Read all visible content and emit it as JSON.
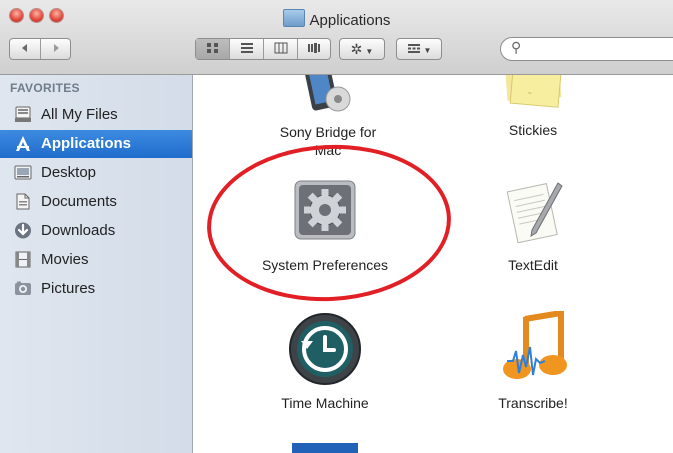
{
  "window": {
    "title": "Applications"
  },
  "toolbar": {
    "back_icon": "back-arrow-icon",
    "forward_icon": "forward-arrow-icon",
    "view_icons": [
      "icon-view-icon",
      "list-view-icon",
      "column-view-icon",
      "coverflow-view-icon"
    ],
    "action_icon": "gear-icon",
    "arrange_icon": "arrange-icon",
    "search_placeholder": ""
  },
  "sidebar": {
    "section": "FAVORITES",
    "items": [
      {
        "label": "All My Files",
        "icon": "all-my-files-icon"
      },
      {
        "label": "Applications",
        "icon": "applications-icon",
        "selected": true
      },
      {
        "label": "Desktop",
        "icon": "desktop-icon"
      },
      {
        "label": "Documents",
        "icon": "documents-icon"
      },
      {
        "label": "Downloads",
        "icon": "downloads-icon"
      },
      {
        "label": "Movies",
        "icon": "movies-icon"
      },
      {
        "label": "Pictures",
        "icon": "pictures-icon"
      }
    ]
  },
  "content": {
    "apps": [
      {
        "name_line1": "Sony Bridge for",
        "name_line2": "Mac",
        "icon": "sony-bridge-icon"
      },
      {
        "name": "Stickies",
        "icon": "stickies-icon"
      },
      {
        "name": "System Preferences",
        "icon": "system-preferences-icon"
      },
      {
        "name": "TextEdit",
        "icon": "textedit-icon"
      },
      {
        "name": "Time Machine",
        "icon": "time-machine-icon"
      },
      {
        "name": "Transcribe!",
        "icon": "transcribe-icon"
      }
    ]
  },
  "colors": {
    "selection": "#2a77d6",
    "highlight_oval": "#e11f24",
    "sidebar_bg": "#dfe6ef"
  }
}
